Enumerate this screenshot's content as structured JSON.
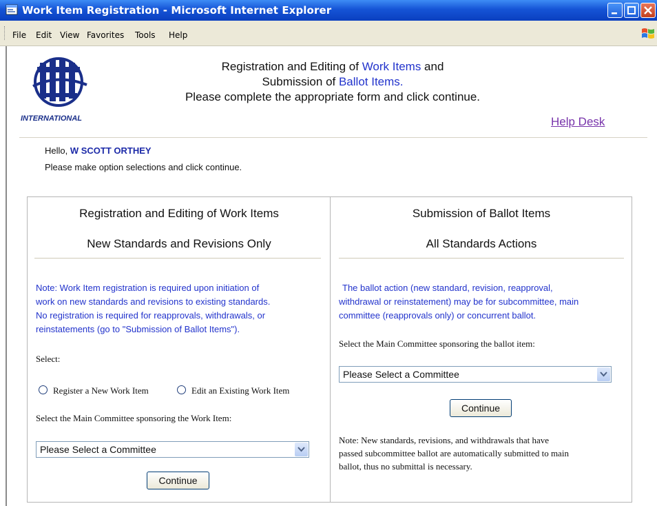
{
  "window": {
    "title": "Work Item Registration - Microsoft Internet Explorer"
  },
  "menu": {
    "items": [
      "File",
      "Edit",
      "View",
      "Favorites",
      "Tools",
      "Help"
    ]
  },
  "logo": {
    "text": "INTERNATIONAL"
  },
  "header": {
    "line1_prefix": "Registration and Editing of ",
    "line1_link": "Work Items",
    "line1_suffix": " and",
    "line2_prefix": "Submission of ",
    "line2_link": "Ballot Items",
    "line2_suffix": ".",
    "line3": "Please complete the appropriate form and click continue.",
    "help_desk": "Help Desk"
  },
  "greeting": {
    "hello": "Hello, ",
    "name": "W SCOTT ORTHEY",
    "instruction": "Please make option selections and click continue."
  },
  "left_panel": {
    "title": "Registration and Editing of Work Items",
    "subtitle": "New Standards and Revisions Only",
    "note_lines": [
      "Note: Work Item registration is required upon initiation of",
      "work on new standards and revisions to existing standards.",
      "No registration is required for reapprovals, withdrawals, or",
      "reinstatements (go to \"Submission of Ballot Items\")."
    ],
    "select_label": "Select:",
    "radio_register": "Register a New Work Item",
    "radio_edit": "Edit an Existing Work Item",
    "committee_label": "Select the Main Committee sponsoring the Work Item:",
    "committee_value": "Please Select a Committee",
    "continue": "Continue"
  },
  "right_panel": {
    "title": "Submission of Ballot Items",
    "subtitle": "All Standards Actions",
    "note_lines": [
      "The ballot action (new standard, revision, reapproval,",
      "withdrawal or reinstatement) may be for subcommittee, main",
      "committee (reapprovals only) or concurrent ballot."
    ],
    "committee_label": "Select the Main Committee sponsoring the ballot item:",
    "committee_value": "Please Select a Committee",
    "continue": "Continue",
    "footnote_lines": [
      "Note: New standards, revisions, and withdrawals that have",
      "passed subcommittee ballot are automatically submitted to main",
      "ballot, thus no submittal is necessary."
    ]
  },
  "colors": {
    "link_blue": "#2233cc",
    "visited_link": "#7733aa",
    "titlebar_blue": "#1554d6"
  }
}
